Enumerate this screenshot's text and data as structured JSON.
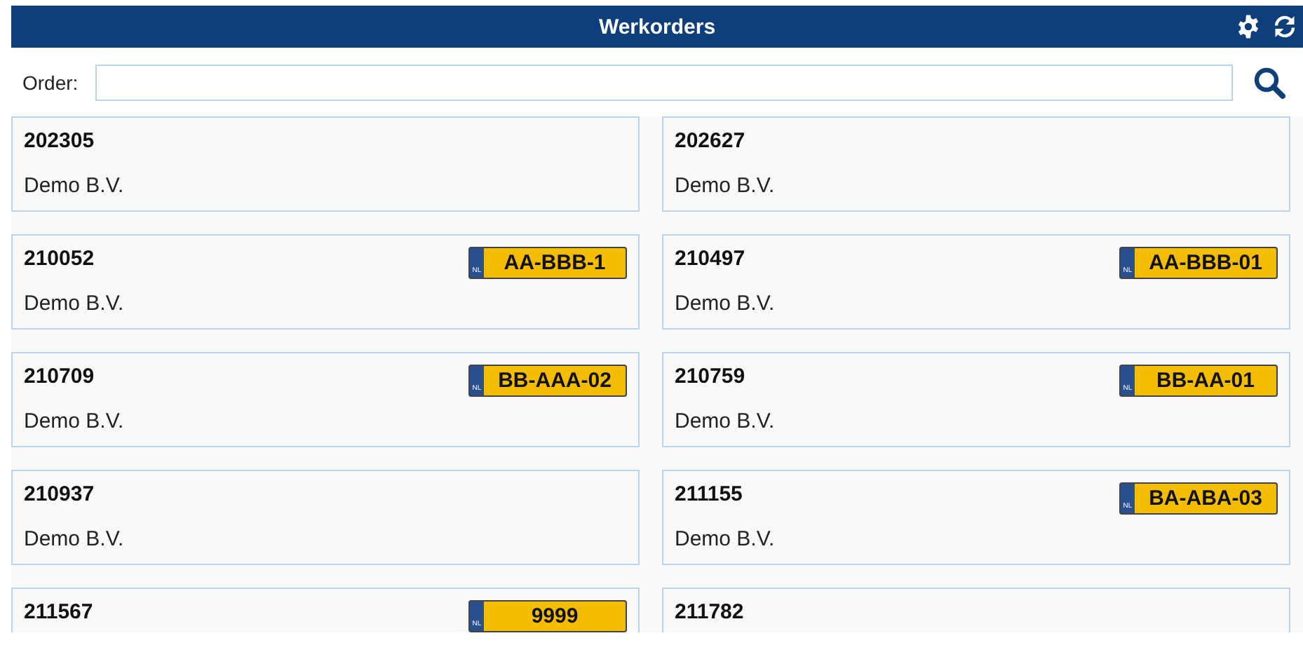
{
  "header": {
    "title": "Werkorders"
  },
  "search": {
    "label": "Order:"
  },
  "orders": [
    {
      "number": "202305",
      "customer": "Demo B.V."
    },
    {
      "number": "202627",
      "customer": "Demo B.V."
    },
    {
      "number": "210052",
      "customer": "Demo B.V.",
      "plate": {
        "country": "NL",
        "text": "AA-BBB-1"
      }
    },
    {
      "number": "210497",
      "customer": "Demo B.V.",
      "plate": {
        "country": "NL",
        "text": "AA-BBB-01"
      }
    },
    {
      "number": "210709",
      "customer": "Demo B.V.",
      "plate": {
        "country": "NL",
        "text": "BB-AAA-02"
      }
    },
    {
      "number": "210759",
      "customer": "Demo B.V.",
      "plate": {
        "country": "NL",
        "text": "BB-AA-01"
      }
    },
    {
      "number": "210937",
      "customer": "Demo B.V."
    },
    {
      "number": "211155",
      "customer": "Demo B.V.",
      "plate": {
        "country": "NL",
        "text": "BA-ABA-03"
      }
    },
    {
      "number": "211567",
      "plate": {
        "country": "NL",
        "text": "9999"
      }
    },
    {
      "number": "211782"
    }
  ]
}
